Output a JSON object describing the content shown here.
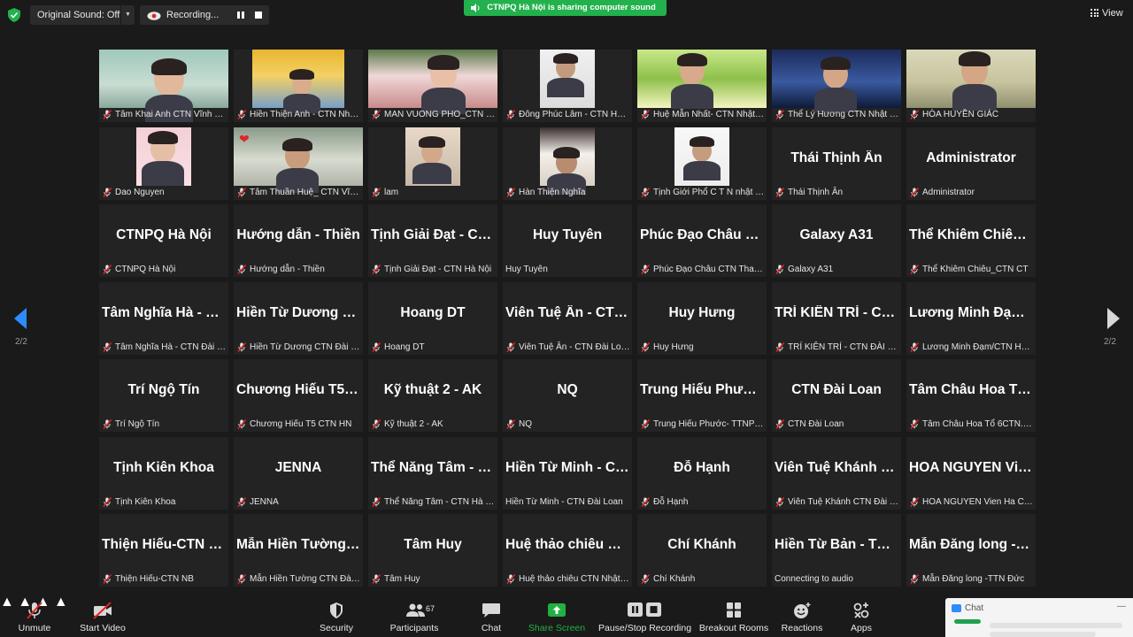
{
  "topbar": {
    "sound_label": "Original Sound: Off",
    "recording_label": "Recording...",
    "share_banner": "CTNPQ Hà Nội is sharing computer sound",
    "view_label": "View"
  },
  "pager": {
    "left": "2/2",
    "right": "2/2"
  },
  "tiles": [
    {
      "label": "Tâm Khai Anh CTN Vĩnh Phúc",
      "video": true
    },
    {
      "label": "Hiền Thiện Anh - CTN Nhật Bản",
      "video": true
    },
    {
      "label": "MAN VUONG PHO_CTN Hà Nội",
      "video": true
    },
    {
      "label": "Đông Phúc Lâm - CTN Hà Nội",
      "video": true
    },
    {
      "label": "Huệ Mẫn Nhất- CTN Nhật Bản",
      "video": true
    },
    {
      "label": "Thể Lý Hương CTN Nhật Bản",
      "video": true
    },
    {
      "label": "HÒA HUYỀN GIÁC",
      "video": true
    },
    {
      "label": "Dao Nguyen",
      "video": true
    },
    {
      "label": "Tâm Thuần Huệ_ CTN Vĩnh Phúc",
      "video": true
    },
    {
      "label": "lam",
      "video": true
    },
    {
      "label": "Hàn Thiện Nghĩa",
      "video": true
    },
    {
      "label": "Tịnh Giới Phổ C T N nhật bản",
      "video": true
    },
    {
      "name": "Thái Thịnh Ân",
      "label": "Thái Thịnh Ân"
    },
    {
      "name": "Administrator",
      "label": "Administrator"
    },
    {
      "name": "CTNPQ Hà Nội",
      "label": "CTNPQ Hà Nội"
    },
    {
      "name": "Hướng dẫn - Thiền",
      "label": "Hướng dẫn - Thiền"
    },
    {
      "name": "Tịnh Giải Đạt - CTN Hà Nội",
      "label": "Tịnh Giải Đạt - CTN Hà Nội"
    },
    {
      "name": "Huy Tuyên",
      "label": "Huy Tuyên",
      "nomic": true
    },
    {
      "name": "Phúc Đạo Châu CTN Thanh Hóa",
      "label": "Phúc Đạo Châu CTN Thanh Hóa"
    },
    {
      "name": "Galaxy A31",
      "label": "Galaxy A31"
    },
    {
      "name": "Thể Khiêm Chiêu_CTN CT",
      "label": "Thể Khiêm Chiêu_CTN CT"
    },
    {
      "name": "Tâm Nghĩa Hà - CTN Đài Loan",
      "label": "Tâm Nghĩa Hà - CTN Đài Loan"
    },
    {
      "name": "Hiền Từ Dương CTN Đài Loan",
      "label": "Hiền Từ Dương CTN Đài Loan"
    },
    {
      "name": "Hoang  DT",
      "label": "Hoang  DT"
    },
    {
      "name": "Viên Tuệ Ân - CTN Đài Loan",
      "label": "Viên Tuệ Ân - CTN Đài Loan"
    },
    {
      "name": "Huy Hưng",
      "label": "Huy Hưng"
    },
    {
      "name": "TRÍ KIÊN TRÍ - CTN ĐÀI LOAN",
      "label": "TRÍ KIÊN TRÍ - CTN ĐÀI LOAN"
    },
    {
      "name": "Lương Minh Đạm/CTN HN",
      "label": "Lương Minh Đạm/CTN Hà Nội"
    },
    {
      "name": "Trí Ngộ Tín",
      "label": "Trí Ngộ Tín"
    },
    {
      "name": "Chương Hiếu T5 CTN HN",
      "label": "Chương Hiếu T5 CTN HN"
    },
    {
      "name": "Kỹ thuật 2 - AK",
      "label": "Kỹ thuật 2 - AK"
    },
    {
      "name": "NQ",
      "label": "NQ"
    },
    {
      "name": "Trung Hiếu Phước- TTNP Đài Loan",
      "label": "Trung Hiếu Phước- TTNP Đài Loan"
    },
    {
      "name": "CTN Đài Loan",
      "label": "CTN Đài Loan"
    },
    {
      "name": "Tâm Châu Hoa Tổ 6CTN.HN",
      "label": "Tâm Châu Hoa Tổ 6CTN.HN"
    },
    {
      "name": "Tịnh Kiên Khoa",
      "label": "Tịnh Kiên Khoa"
    },
    {
      "name": "JENNA",
      "label": "JENNA"
    },
    {
      "name": "Thể Năng Tâm - CTN Hà Nội",
      "label": "Thể Năng Tâm - CTN Hà Nội"
    },
    {
      "name": "Hiền Từ Minh - CTN Đài Loan",
      "label": "Hiền Từ Minh - CTN Đài Loan",
      "nomic": true
    },
    {
      "name": "Đỗ Hạnh",
      "label": "Đỗ Hạnh"
    },
    {
      "name": "Viên Tuệ  Khánh CTN Đài Loan",
      "label": "Viên Tuệ  Khánh CTN Đài Loan"
    },
    {
      "name": "HOA NGUYEN Vien Ha CTN",
      "label": "HOA NGUYEN Vien Ha CTN"
    },
    {
      "name": "Thiện Hiếu-CTN NB",
      "label": "Thiện Hiếu-CTN NB"
    },
    {
      "name": "Mẫn Hiền Tường CTN Đài Loan",
      "label": "Mẫn Hiền Tường CTN Đài Loan"
    },
    {
      "name": "Tâm Huy",
      "label": "Tâm Huy"
    },
    {
      "name": "Huệ thảo chiêu CTN Nhật Bản",
      "label": "Huệ thảo chiêu CTN Nhật Bản"
    },
    {
      "name": "Chí Khánh",
      "label": "Chí Khánh"
    },
    {
      "name": "Hiền Từ Bản - TTN Đài Loan",
      "label": "Connecting to audio ",
      "nomic": true
    },
    {
      "name": "Mẫn Đăng long -TTN Đức",
      "label": "Mẫn Đăng long -TTN Đức"
    }
  ],
  "toolbar": {
    "unmute": "Unmute",
    "start_video": "Start Video",
    "security": "Security",
    "participants": "Participants",
    "participants_count": "67",
    "chat": "Chat",
    "share_screen": "Share Screen",
    "pause_stop": "Pause/Stop Recording",
    "breakout": "Breakout Rooms",
    "reactions": "Reactions",
    "apps": "Apps"
  },
  "chat_panel": {
    "title": "Chat"
  },
  "colors": {
    "accent_green": "#22b14c",
    "share_green": "#1fb141",
    "muted_red": "#e02424",
    "tile_bg": "#232323"
  }
}
